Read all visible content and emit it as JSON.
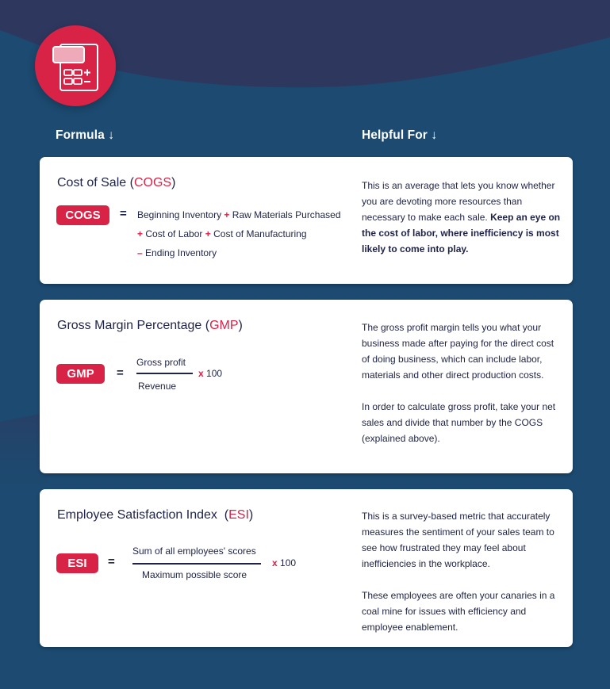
{
  "colors": {
    "background_top": "#2e375e",
    "background_main": "#1c4a70",
    "accent": "#d82347",
    "card": "#ffffff",
    "text": "#1e2347"
  },
  "hero_icon": "calculator-icon",
  "headers": {
    "formula": "Formula",
    "helpful_for": "Helpful For",
    "arrow_icon": "arrow-down-icon",
    "arrow_glyph": "↓"
  },
  "cards": [
    {
      "title_prefix": "Cost of Sale (",
      "title_abbr": "COGS",
      "title_suffix": ")",
      "badge": "COGS",
      "equals": "=",
      "formula_lines": [
        {
          "op": "",
          "a": "Beginning Inventory",
          "op2": "+",
          "b": "Raw Materials Purchased"
        },
        {
          "op": "+",
          "a": "Cost of Labor",
          "op2": "+",
          "b": "Cost of Manufacturing"
        },
        {
          "op": "–",
          "a": "Ending Inventory",
          "op2": "",
          "b": ""
        }
      ],
      "description": {
        "normal": "This is an average that lets you know whether you are devoting more resources than necessary to make each sale. ",
        "bold": "Keep an eye on the cost of labor, where inefficiency is most likely to come into play."
      }
    },
    {
      "title_prefix": "Gross Margin Percentage (",
      "title_abbr": "GMP",
      "title_suffix": ")",
      "badge": "GMP",
      "equals": "=",
      "numerator": "Gross profit",
      "denominator": "Revenue",
      "multiplier_sign": "x",
      "multiplier": "100",
      "description_paragraphs": [
        "The gross profit margin tells you what your business made after paying for the direct cost of doing business, which can include labor, materials and other direct production costs.",
        "In order to calculate gross profit, take your net sales and divide that number by the COGS (explained above)."
      ]
    },
    {
      "title_prefix": "Employee Satisfaction Index  (",
      "title_abbr": "ESI",
      "title_suffix": ")",
      "badge": "ESI",
      "equals": "=",
      "numerator": "Sum of all employees' scores",
      "denominator": "Maximum possible score",
      "multiplier_sign": "x",
      "multiplier": "100",
      "description_paragraphs": [
        "This is a survey-based metric that accurately measures the sentiment of your sales team to see how frustrated they may feel about inefficiencies in the workplace.",
        "These employees are often your canaries in a coal mine for issues with efficiency and employee enablement."
      ]
    }
  ]
}
